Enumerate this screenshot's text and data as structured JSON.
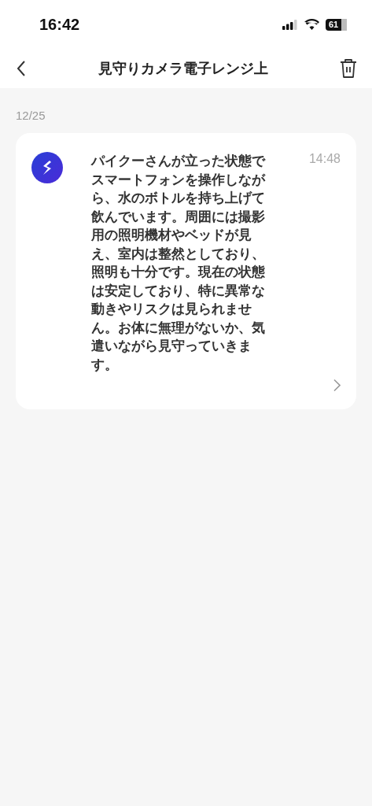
{
  "status_bar": {
    "time": "16:42",
    "battery": "61"
  },
  "header": {
    "title": "見守りカメラ電子レンジ上"
  },
  "date": "12/25",
  "messages": [
    {
      "text": "パイクーさんが立った状態でスマートフォンを操作しながら、水のボトルを持ち上げて飲んでいます。周囲には撮影用の照明機材やベッドが見え、室内は整然としており、照明も十分です。現在の状態は安定しており、特に異常な動きやリスクは見られません。お体に無理がないか、気遣いながら見守っていきます。",
      "time": "14:48"
    }
  ]
}
